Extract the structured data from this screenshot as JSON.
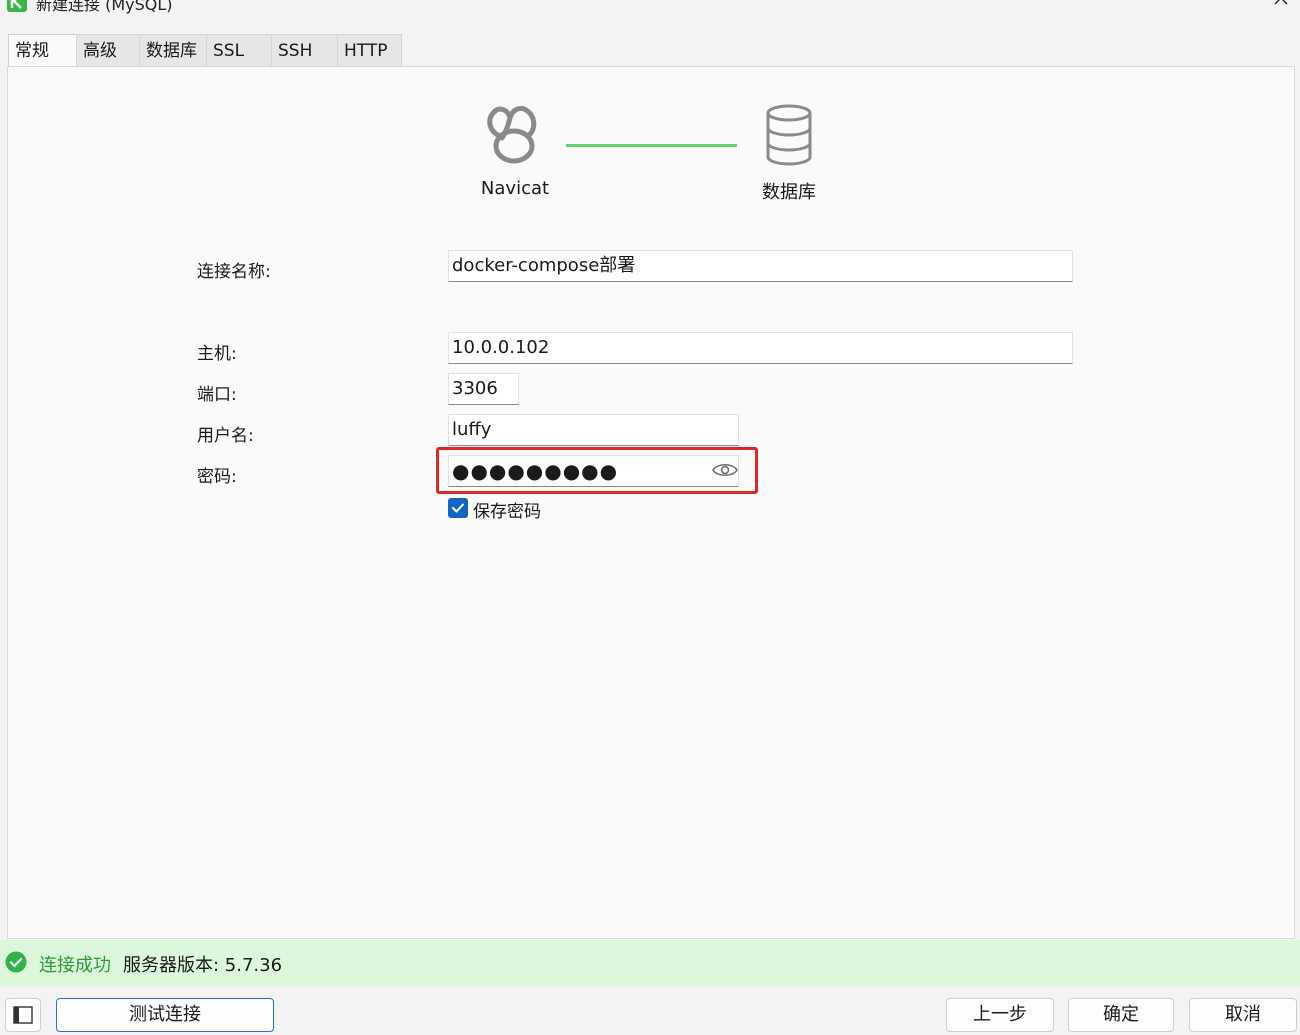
{
  "window": {
    "title": "新建连接 (MySQL)"
  },
  "tabs": [
    {
      "label": "常规",
      "active": true
    },
    {
      "label": "高级",
      "active": false
    },
    {
      "label": "数据库",
      "active": false
    },
    {
      "label": "SSL",
      "active": false
    },
    {
      "label": "SSH",
      "active": false
    },
    {
      "label": "HTTP",
      "active": false
    }
  ],
  "diagram": {
    "left_label": "Navicat",
    "right_label": "数据库",
    "left_icon": "navicat-logo-icon",
    "right_icon": "database-icon",
    "link_color": "#62d46a"
  },
  "form": {
    "connection_name": {
      "label": "连接名称:",
      "value": "docker-compose部署"
    },
    "host": {
      "label": "主机:",
      "value": "10.0.0.102"
    },
    "port": {
      "label": "端口:",
      "value": "3306"
    },
    "username": {
      "label": "用户名:",
      "value": "luffy"
    },
    "password": {
      "label": "密码:",
      "value": "●●●●●●●●●"
    },
    "save_password": {
      "label": "保存密码",
      "checked": true
    }
  },
  "status": {
    "icon": "check-circle-icon",
    "result": "连接成功",
    "server_version": "服务器版本: 5.7.36",
    "color": "#2e9a3a",
    "background": "#dcf7dc"
  },
  "buttons": {
    "test": "测试连接",
    "back": "上一步",
    "ok": "确定",
    "cancel": "取消"
  },
  "colors": {
    "highlight": "#e12626",
    "checkbox": "#1565c0"
  }
}
